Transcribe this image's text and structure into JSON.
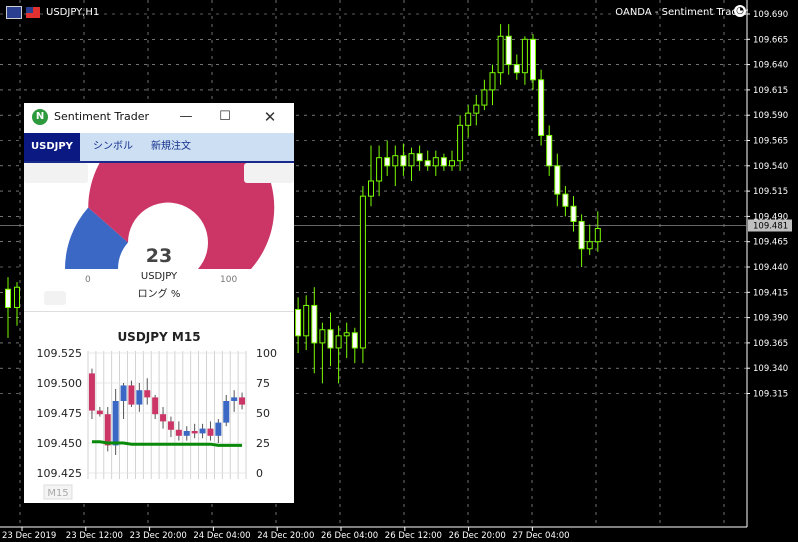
{
  "main_chart": {
    "symbol_title": "USDJPY,H1",
    "broker_label": "OANDA - Sentiment Trader",
    "price_axis": [
      "109.690",
      "109.665",
      "109.640",
      "109.615",
      "109.590",
      "109.565",
      "109.540",
      "109.515",
      "109.490",
      "109.465",
      "109.440",
      "109.415",
      "109.390",
      "109.365",
      "109.340",
      "109.315"
    ],
    "current_price": "109.481",
    "time_axis": [
      "23 Dec 2019",
      "23 Dec 12:00",
      "23 Dec 20:00",
      "24 Dec 04:00",
      "24 Dec 20:00",
      "26 Dec 04:00",
      "26 Dec 12:00",
      "26 Dec 20:00",
      "27 Dec 04:00"
    ],
    "ohlc_visible": [
      {
        "o": 109.418,
        "h": 109.43,
        "l": 109.37,
        "c": 109.4
      },
      {
        "o": 109.4,
        "h": 109.425,
        "l": 109.382,
        "c": 109.42
      },
      {
        "o": 109.42,
        "h": 109.428,
        "l": 109.39,
        "c": 109.398
      },
      {
        "o": 109.398,
        "h": 109.41,
        "l": 109.355,
        "c": 109.372
      },
      {
        "o": 109.372,
        "h": 109.412,
        "l": 109.358,
        "c": 109.402
      },
      {
        "o": 109.402,
        "h": 109.42,
        "l": 109.335,
        "c": 109.365
      },
      {
        "o": 109.365,
        "h": 109.385,
        "l": 109.325,
        "c": 109.378
      },
      {
        "o": 109.378,
        "h": 109.395,
        "l": 109.342,
        "c": 109.36
      },
      {
        "o": 109.36,
        "h": 109.382,
        "l": 109.325,
        "c": 109.372
      },
      {
        "o": 109.372,
        "h": 109.385,
        "l": 109.35,
        "c": 109.375
      },
      {
        "o": 109.375,
        "h": 109.38,
        "l": 109.345,
        "c": 109.36
      },
      {
        "o": 109.36,
        "h": 109.52,
        "l": 109.345,
        "c": 109.51
      },
      {
        "o": 109.51,
        "h": 109.56,
        "l": 109.5,
        "c": 109.525
      },
      {
        "o": 109.525,
        "h": 109.56,
        "l": 109.51,
        "c": 109.548
      },
      {
        "o": 109.548,
        "h": 109.565,
        "l": 109.53,
        "c": 109.54
      },
      {
        "o": 109.54,
        "h": 109.56,
        "l": 109.52,
        "c": 109.55
      },
      {
        "o": 109.55,
        "h": 109.562,
        "l": 109.53,
        "c": 109.54
      },
      {
        "o": 109.54,
        "h": 109.558,
        "l": 109.525,
        "c": 109.552
      },
      {
        "o": 109.552,
        "h": 109.56,
        "l": 109.535,
        "c": 109.545
      },
      {
        "o": 109.545,
        "h": 109.555,
        "l": 109.535,
        "c": 109.54
      },
      {
        "o": 109.54,
        "h": 109.555,
        "l": 109.53,
        "c": 109.548
      },
      {
        "o": 109.548,
        "h": 109.552,
        "l": 109.535,
        "c": 109.54
      },
      {
        "o": 109.54,
        "h": 109.555,
        "l": 109.535,
        "c": 109.545
      },
      {
        "o": 109.545,
        "h": 109.59,
        "l": 109.535,
        "c": 109.58
      },
      {
        "o": 109.58,
        "h": 109.6,
        "l": 109.568,
        "c": 109.592
      },
      {
        "o": 109.592,
        "h": 109.61,
        "l": 109.58,
        "c": 109.6
      },
      {
        "o": 109.6,
        "h": 109.625,
        "l": 109.595,
        "c": 109.615
      },
      {
        "o": 109.615,
        "h": 109.64,
        "l": 109.6,
        "c": 109.632
      },
      {
        "o": 109.632,
        "h": 109.68,
        "l": 109.62,
        "c": 109.668
      },
      {
        "o": 109.668,
        "h": 109.68,
        "l": 109.63,
        "c": 109.64
      },
      {
        "o": 109.64,
        "h": 109.65,
        "l": 109.625,
        "c": 109.632
      },
      {
        "o": 109.632,
        "h": 109.668,
        "l": 109.62,
        "c": 109.665
      },
      {
        "o": 109.665,
        "h": 109.67,
        "l": 109.615,
        "c": 109.625
      },
      {
        "o": 109.625,
        "h": 109.635,
        "l": 109.56,
        "c": 109.57
      },
      {
        "o": 109.57,
        "h": 109.58,
        "l": 109.53,
        "c": 109.54
      },
      {
        "o": 109.54,
        "h": 109.552,
        "l": 109.5,
        "c": 109.512
      },
      {
        "o": 109.512,
        "h": 109.52,
        "l": 109.49,
        "c": 109.5
      },
      {
        "o": 109.5,
        "h": 109.51,
        "l": 109.475,
        "c": 109.485
      },
      {
        "o": 109.485,
        "h": 109.492,
        "l": 109.44,
        "c": 109.458
      },
      {
        "o": 109.458,
        "h": 109.482,
        "l": 109.452,
        "c": 109.465
      },
      {
        "o": 109.465,
        "h": 109.495,
        "l": 109.455,
        "c": 109.478
      }
    ]
  },
  "panel": {
    "title": "Sentiment Trader",
    "app_icon_letter": "N",
    "window_buttons": {
      "minimize": "—",
      "maximize": "☐",
      "close": "✕"
    },
    "tabs": [
      {
        "label": "USDJPY",
        "active": true
      },
      {
        "label": "シンボル",
        "active": false
      },
      {
        "label": "新規注文",
        "active": false
      }
    ],
    "gauge": {
      "value": "23",
      "symbol": "USDJPY",
      "caption": "ロング %",
      "min": "0",
      "max": "100",
      "long_percent": 23,
      "long_color": "#3a68c4",
      "short_color": "#cc3666"
    },
    "mini_chart": {
      "title": "USDJPY M15",
      "timeframe": "M15",
      "left_axis": [
        "109.525",
        "109.500",
        "109.475",
        "109.450",
        "109.425"
      ],
      "right_axis": [
        "100",
        "75",
        "50",
        "25",
        "0"
      ]
    }
  },
  "chart_data": {
    "type": "candlestick",
    "title": "USDJPY M15",
    "ylim": [
      109.425,
      109.525
    ],
    "y2lim": [
      0,
      100
    ],
    "up_color": "#3a68c4",
    "down_color": "#cc3666",
    "sentiment_color": "#0a8a0a",
    "candles": [
      {
        "o": 109.508,
        "h": 109.512,
        "l": 109.47,
        "c": 109.477
      },
      {
        "o": 109.477,
        "h": 109.48,
        "l": 109.472,
        "c": 109.474
      },
      {
        "o": 109.474,
        "h": 109.48,
        "l": 109.443,
        "c": 109.448
      },
      {
        "o": 109.448,
        "h": 109.495,
        "l": 109.44,
        "c": 109.485
      },
      {
        "o": 109.485,
        "h": 109.5,
        "l": 109.47,
        "c": 109.498
      },
      {
        "o": 109.498,
        "h": 109.502,
        "l": 109.48,
        "c": 109.482
      },
      {
        "o": 109.482,
        "h": 109.5,
        "l": 109.476,
        "c": 109.494
      },
      {
        "o": 109.494,
        "h": 109.504,
        "l": 109.482,
        "c": 109.488
      },
      {
        "o": 109.488,
        "h": 109.49,
        "l": 109.47,
        "c": 109.474
      },
      {
        "o": 109.474,
        "h": 109.48,
        "l": 109.462,
        "c": 109.468
      },
      {
        "o": 109.468,
        "h": 109.472,
        "l": 109.455,
        "c": 109.461
      },
      {
        "o": 109.461,
        "h": 109.468,
        "l": 109.452,
        "c": 109.456
      },
      {
        "o": 109.456,
        "h": 109.464,
        "l": 109.452,
        "c": 109.46
      },
      {
        "o": 109.46,
        "h": 109.466,
        "l": 109.454,
        "c": 109.458
      },
      {
        "o": 109.458,
        "h": 109.466,
        "l": 109.454,
        "c": 109.462
      },
      {
        "o": 109.462,
        "h": 109.468,
        "l": 109.452,
        "c": 109.456
      },
      {
        "o": 109.456,
        "h": 109.47,
        "l": 109.45,
        "c": 109.467
      },
      {
        "o": 109.467,
        "h": 109.49,
        "l": 109.464,
        "c": 109.485
      },
      {
        "o": 109.485,
        "h": 109.494,
        "l": 109.476,
        "c": 109.488
      },
      {
        "o": 109.488,
        "h": 109.492,
        "l": 109.478,
        "c": 109.482
      }
    ],
    "sentiment_series": {
      "values": [
        26,
        26,
        25,
        25,
        25,
        24,
        24,
        24,
        24,
        24,
        24,
        24,
        24,
        24,
        24,
        24,
        23,
        23,
        23,
        23
      ]
    }
  }
}
